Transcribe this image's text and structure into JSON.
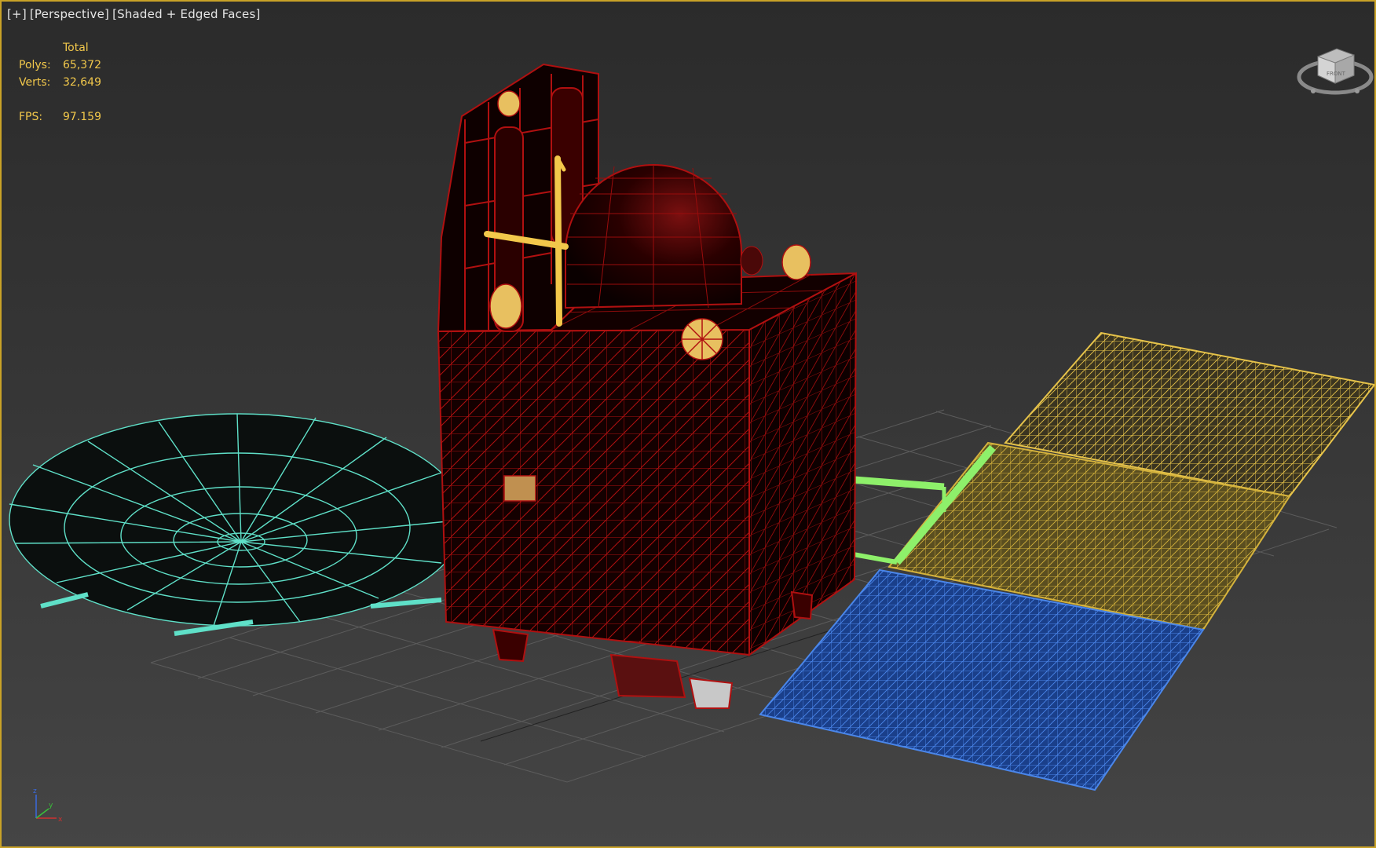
{
  "viewport": {
    "label": {
      "plus": "[+]",
      "view": "[Perspective]",
      "shading": "[Shaded + Edged Faces]"
    },
    "stats": {
      "header": "Total",
      "polys_label": "Polys:",
      "polys_value": "65,372",
      "verts_label": "Verts:",
      "verts_value": "32,649",
      "fps_label": "FPS:",
      "fps_value": "97.159"
    },
    "viewcube": {
      "face_label": "FRONT"
    },
    "axis_tripod": {
      "x": "x",
      "y": "y",
      "z": "z"
    },
    "colors": {
      "border": "#c9a227",
      "stats_text": "#f2c84b",
      "satellite_body_wire": "#b01010",
      "dish_wire": "#5fe0c8",
      "solar_panel_yellow": "#e6c34a",
      "solar_panel_blue": "#3f7be0",
      "boom_green": "#8ef06a",
      "hinge_magenta": "#e040e0"
    }
  }
}
